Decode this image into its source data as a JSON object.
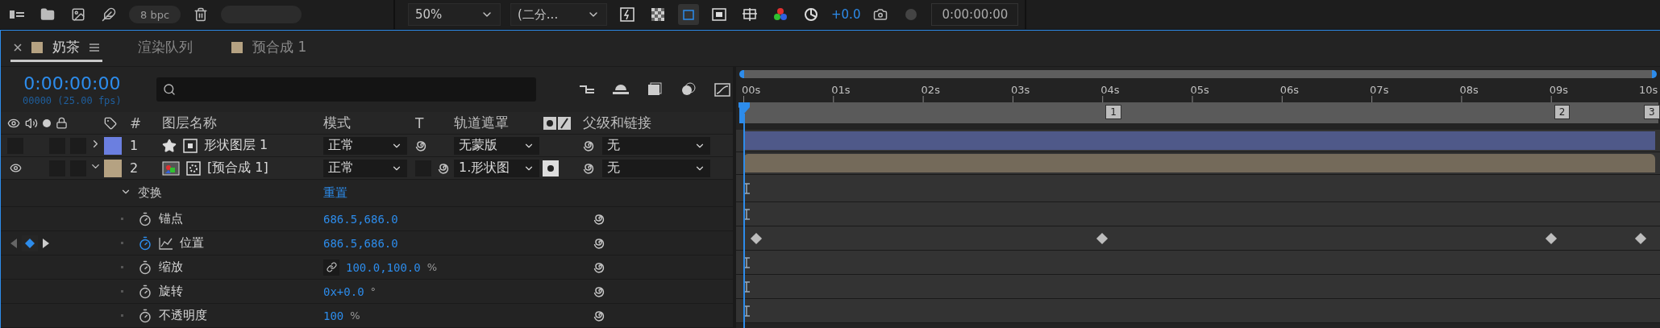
{
  "toolbar_left": {
    "bit_depth": "8 bpc"
  },
  "toolbar_right": {
    "zoom": "50%",
    "resolution": "(二分...",
    "exposure": "+0.0",
    "timecode": "0:00:00:00"
  },
  "tabs": [
    {
      "label": "奶茶",
      "selected": true,
      "color": "#b5a282"
    },
    {
      "label": "渲染队列",
      "selected": false
    },
    {
      "label": "预合成 1",
      "selected": false,
      "color": "#b5a282"
    }
  ],
  "current_time": "0:00:00:00",
  "frame_info": "00000 (25.00 fps)",
  "columns": {
    "number": "#",
    "name": "图层名称",
    "mode": "模式",
    "t": "T",
    "track_matte": "轨道遮罩",
    "parent": "父级和链接"
  },
  "layers": [
    {
      "number": "1",
      "name": "形状图层 1",
      "kind": "shape",
      "color": "#6b7fe0",
      "visible": false,
      "expanded": false,
      "mode": "正常",
      "track_matte": "无蒙版",
      "matte_active": false,
      "parent": "无"
    },
    {
      "number": "2",
      "name": "[预合成 1]",
      "kind": "precomp",
      "color": "#b5a282",
      "visible": true,
      "expanded": true,
      "mode": "正常",
      "track_matte": "1.形状图",
      "matte_active": true,
      "parent": "无"
    }
  ],
  "transform": {
    "label": "变换",
    "expanded": true,
    "reset": "重置",
    "properties": [
      {
        "name": "锚点",
        "value": "686.5,686.0",
        "animated": false
      },
      {
        "name": "位置",
        "value": "686.5,686.0",
        "animated": true,
        "keyframes": [
          true,
          false,
          false,
          false,
          true,
          false,
          false,
          false,
          false,
          true,
          true
        ]
      },
      {
        "name": "缩放",
        "value": "100.0,100.0",
        "unit": "%",
        "linked": true,
        "animated": false
      },
      {
        "name": "旋转",
        "value": "0x+0.0",
        "unit": "°",
        "animated": false
      },
      {
        "name": "不透明度",
        "value": "100",
        "unit": "%",
        "animated": false
      }
    ]
  },
  "timeline": {
    "ticks": [
      {
        "label": "00s",
        "current": true
      },
      {
        "label": "01s",
        "current": false
      },
      {
        "label": "02s",
        "current": false
      },
      {
        "label": "03s",
        "current": false
      },
      {
        "label": "04s",
        "current": false,
        "marker": "1"
      },
      {
        "label": "05s",
        "current": false
      },
      {
        "label": "06s",
        "current": false
      },
      {
        "label": "07s",
        "current": false
      },
      {
        "label": "08s",
        "current": false
      },
      {
        "label": "09s",
        "current": false,
        "marker": "2"
      },
      {
        "label": "10s",
        "current": false,
        "marker": "3"
      }
    ]
  }
}
